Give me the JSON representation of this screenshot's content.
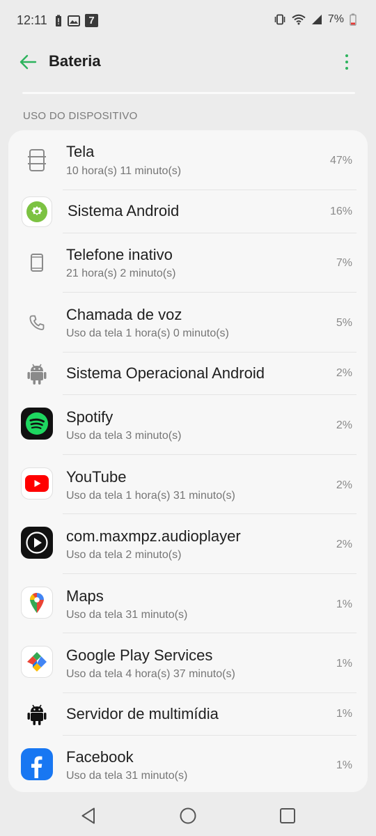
{
  "status_bar": {
    "time": "12:11",
    "notification_badge": "7",
    "battery_percent": "7%"
  },
  "app_bar": {
    "title": "Bateria",
    "back_icon": "arrow-left-icon",
    "menu_icon": "more-vert-icon"
  },
  "section_header": "USO DO DISPOSITIVO",
  "items": [
    {
      "title": "Tela",
      "subtitle": "10 hora(s) 11 minuto(s)",
      "percent": "47%",
      "icon": "screen-icon"
    },
    {
      "title": "Sistema Android",
      "subtitle": "",
      "percent": "16%",
      "icon": "android-system-settings-icon"
    },
    {
      "title": "Telefone inativo",
      "subtitle": "21 hora(s) 2 minuto(s)",
      "percent": "7%",
      "icon": "phone-idle-icon"
    },
    {
      "title": "Chamada de voz",
      "subtitle": "Uso da tela 1 hora(s) 0 minuto(s)",
      "percent": "5%",
      "icon": "phone-call-icon"
    },
    {
      "title": "Sistema Operacional Android",
      "subtitle": "",
      "percent": "2%",
      "icon": "android-os-icon"
    },
    {
      "title": "Spotify",
      "subtitle": "Uso da tela 3 minuto(s)",
      "percent": "2%",
      "icon": "spotify-icon"
    },
    {
      "title": "YouTube",
      "subtitle": "Uso da tela 1 hora(s) 31 minuto(s)",
      "percent": "2%",
      "icon": "youtube-icon"
    },
    {
      "title": "com.maxmpz.audioplayer",
      "subtitle": "Uso da tela 2 minuto(s)",
      "percent": "2%",
      "icon": "audioplayer-icon"
    },
    {
      "title": "Maps",
      "subtitle": "Uso da tela 31 minuto(s)",
      "percent": "1%",
      "icon": "maps-icon"
    },
    {
      "title": "Google Play Services",
      "subtitle": "Uso da tela 4 hora(s) 37 minuto(s)",
      "percent": "1%",
      "icon": "google-play-services-icon"
    },
    {
      "title": "Servidor de multimídia",
      "subtitle": "",
      "percent": "1%",
      "icon": "android-media-server-icon"
    },
    {
      "title": "Facebook",
      "subtitle": "Uso da tela 31 minuto(s)",
      "percent": "1%",
      "icon": "facebook-icon"
    }
  ],
  "colors": {
    "accent": "#2db35d",
    "background": "#ececec",
    "card": "#f7f7f7",
    "spotify": "#1ed760",
    "youtube": "#ff0000",
    "facebook": "#1877f2"
  },
  "nav_bar": {
    "back": "nav-back-icon",
    "home": "nav-home-icon",
    "recents": "nav-recents-icon"
  }
}
